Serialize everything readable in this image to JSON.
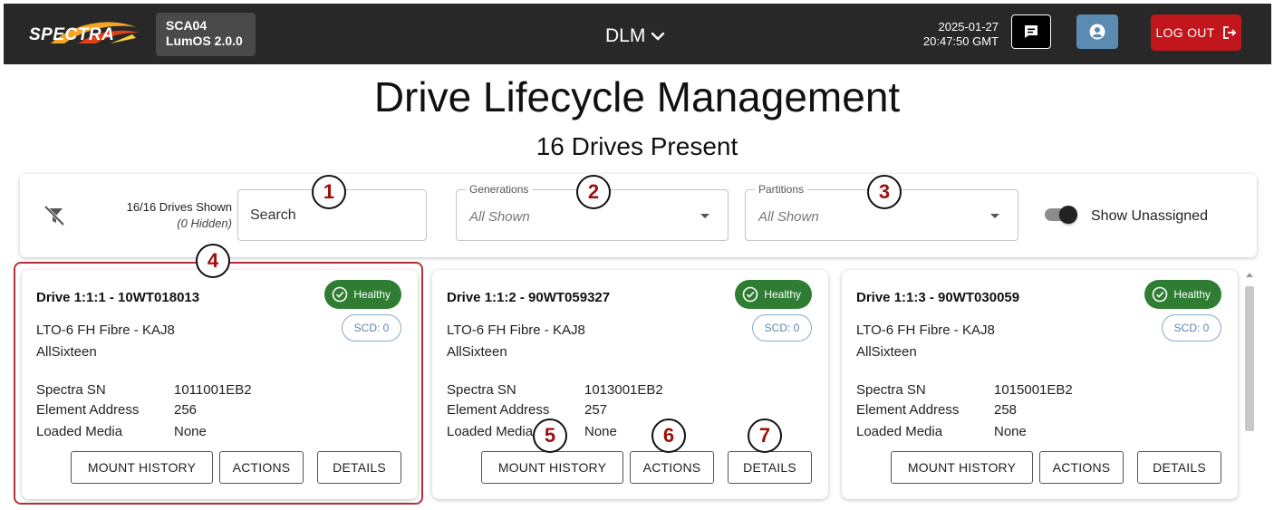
{
  "header": {
    "logo_text": "SPECTRA",
    "system_name": "SCA04",
    "system_version": "LumOS 2.0.0",
    "menu_label": "DLM",
    "date": "2025-01-27",
    "time": "20:47:50 GMT",
    "logout_label": "LOG OUT",
    "icons": {
      "messages": "message-icon",
      "user": "user-icon",
      "logout": "logout-icon",
      "menu": "chevron-down-icon"
    },
    "colors": {
      "bar": "#282828",
      "logout": "#c1161c",
      "user_button": "#5a8bb0"
    }
  },
  "page": {
    "title": "Drive Lifecycle Management",
    "subtitle": "16 Drives Present"
  },
  "filters": {
    "drives_shown": "16/16 Drives Shown",
    "hidden": "(0 Hidden)",
    "search_placeholder": "Search",
    "generations_label": "Generations",
    "generations_value": "All Shown",
    "partitions_label": "Partitions",
    "partitions_value": "All Shown",
    "show_unassigned_label": "Show Unassigned",
    "show_unassigned_on": true,
    "icons": {
      "clear_filter": "filter-off-icon"
    }
  },
  "callouts": [
    "1",
    "2",
    "3",
    "4",
    "5",
    "6",
    "7"
  ],
  "drives": [
    {
      "title": "Drive 1:1:1 - 10WT018013",
      "status": "Healthy",
      "scd": "SCD: 0",
      "model": "LTO-6 FH Fibre - KAJ8",
      "partition": "AllSixteen",
      "spectra_sn_label": "Spectra SN",
      "spectra_sn": "1011001EB2",
      "element_address_label": "Element Address",
      "element_address": "256",
      "loaded_media_label": "Loaded Media",
      "loaded_media": "None",
      "mount_history_label": "MOUNT HISTORY",
      "actions_label": "ACTIONS",
      "details_label": "DETAILS"
    },
    {
      "title": "Drive 1:1:2 - 90WT059327",
      "status": "Healthy",
      "scd": "SCD: 0",
      "model": "LTO-6 FH Fibre - KAJ8",
      "partition": "AllSixteen",
      "spectra_sn_label": "Spectra SN",
      "spectra_sn": "1013001EB2",
      "element_address_label": "Element Address",
      "element_address": "257",
      "loaded_media_label": "Loaded Media",
      "loaded_media": "None",
      "mount_history_label": "MOUNT HISTORY",
      "actions_label": "ACTIONS",
      "details_label": "DETAILS"
    },
    {
      "title": "Drive 1:1:3 - 90WT030059",
      "status": "Healthy",
      "scd": "SCD: 0",
      "model": "LTO-6 FH Fibre - KAJ8",
      "partition": "AllSixteen",
      "spectra_sn_label": "Spectra SN",
      "spectra_sn": "1015001EB2",
      "element_address_label": "Element Address",
      "element_address": "258",
      "loaded_media_label": "Loaded Media",
      "loaded_media": "None",
      "mount_history_label": "MOUNT HISTORY",
      "actions_label": "ACTIONS",
      "details_label": "DETAILS"
    }
  ],
  "status_colors": {
    "healthy": "#2e7d32",
    "highlight": "#b5303a",
    "callout_text": "#a10e0e"
  }
}
